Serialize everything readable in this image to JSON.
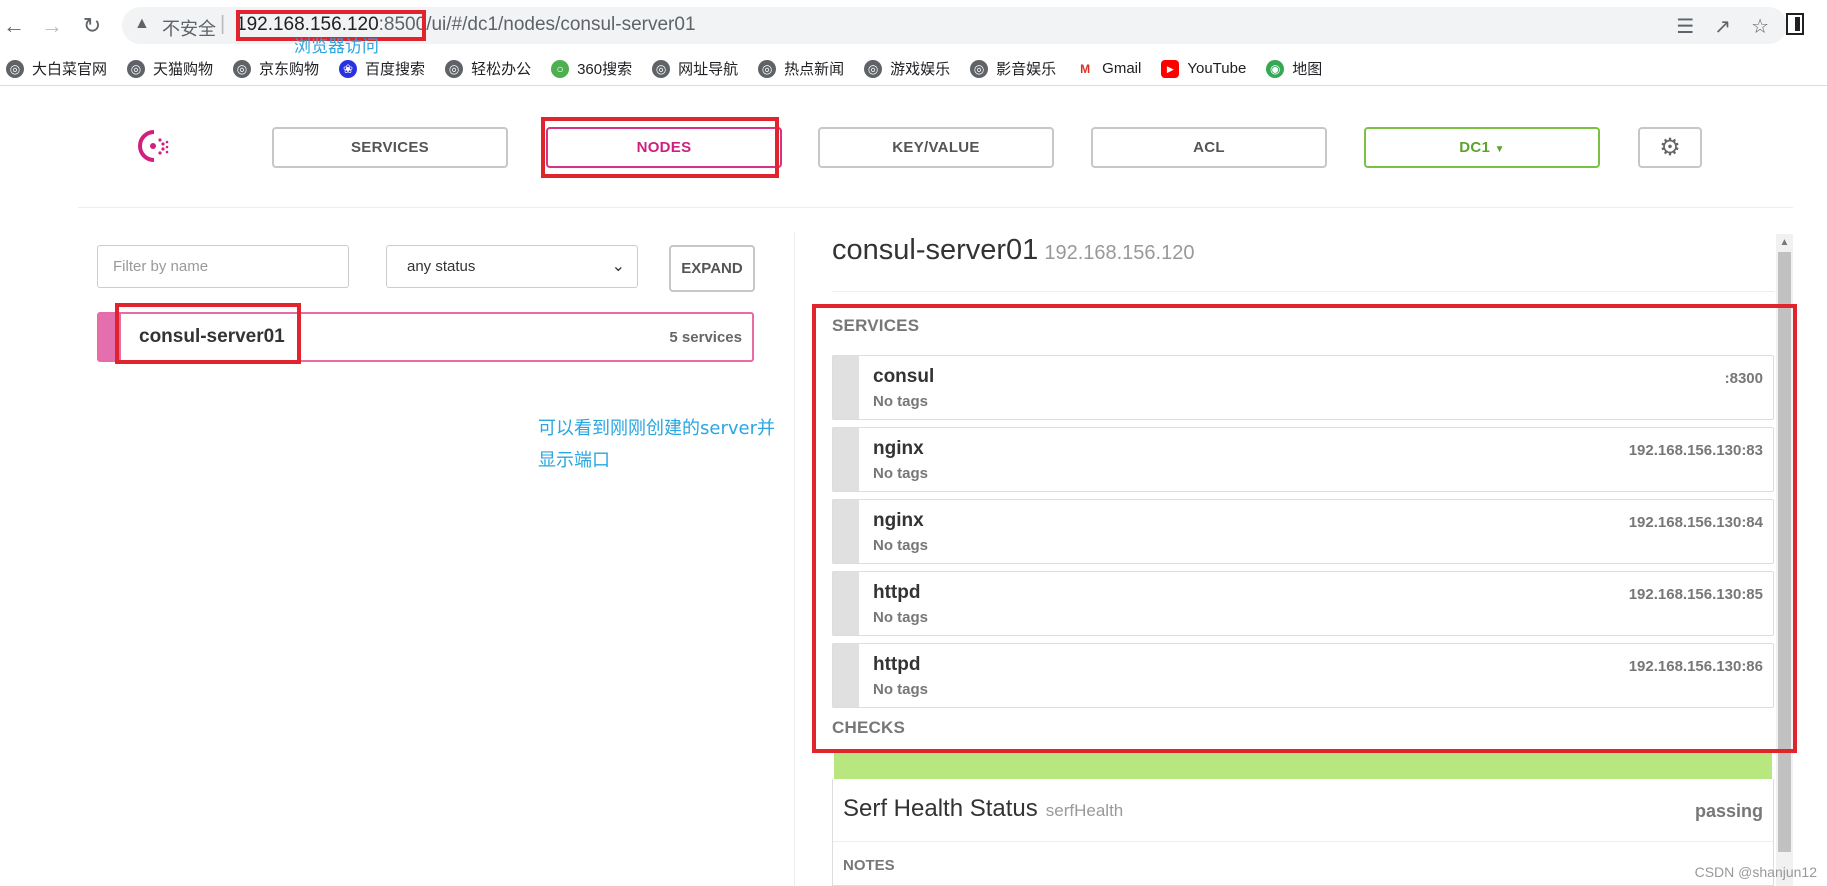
{
  "browser": {
    "security_label": "不安全",
    "url_host": "192.168.156.120",
    "url_port": ":8500",
    "url_path": "/ui/#/dc1/nodes/consul-server01",
    "bookmarks": [
      {
        "label": "大白菜官网",
        "icon": "globe-icon"
      },
      {
        "label": "天猫购物",
        "icon": "globe-icon"
      },
      {
        "label": "京东购物",
        "icon": "globe-icon"
      },
      {
        "label": "百度搜索",
        "icon": "baidu-paw-icon"
      },
      {
        "label": "轻松办公",
        "icon": "globe-icon"
      },
      {
        "label": "360搜索",
        "icon": "360-icon"
      },
      {
        "label": "网址导航",
        "icon": "globe-icon"
      },
      {
        "label": "热点新闻",
        "icon": "globe-icon"
      },
      {
        "label": "游戏娱乐",
        "icon": "globe-icon"
      },
      {
        "label": "影音娱乐",
        "icon": "globe-icon"
      },
      {
        "label": "Gmail",
        "icon": "gmail-icon"
      },
      {
        "label": "YouTube",
        "icon": "youtube-icon"
      },
      {
        "label": "地图",
        "icon": "maps-icon"
      }
    ]
  },
  "annotations": {
    "url_note": "浏览器访问",
    "server_note_line1": "可以看到刚刚创建的server并",
    "server_note_line2": "显示端口",
    "watermark": "CSDN @shanjun12",
    "highlight_color": "#e0242e"
  },
  "nav": {
    "services": "SERVICES",
    "nodes": "NODES",
    "keyvalue": "KEY/VALUE",
    "acl": "ACL",
    "dc": "DC1",
    "active": "nodes",
    "accent_color": "#d0207e",
    "dc_color": "#5ca32f"
  },
  "filters": {
    "name_placeholder": "Filter by name",
    "status_value": "any status",
    "expand_label": "EXPAND"
  },
  "node_list": [
    {
      "name": "consul-server01",
      "services": "5 services"
    }
  ],
  "node_detail": {
    "name": "consul-server01",
    "address": "192.168.156.120",
    "services_header": "SERVICES",
    "checks_header": "CHECKS",
    "services": [
      {
        "name": "consul",
        "tags": "No tags",
        "address": ":8300"
      },
      {
        "name": "nginx",
        "tags": "No tags",
        "address": "192.168.156.130:83"
      },
      {
        "name": "nginx",
        "tags": "No tags",
        "address": "192.168.156.130:84"
      },
      {
        "name": "httpd",
        "tags": "No tags",
        "address": "192.168.156.130:85"
      },
      {
        "name": "httpd",
        "tags": "No tags",
        "address": "192.168.156.130:86"
      }
    ],
    "check": {
      "name": "Serf Health Status",
      "id": "serfHealth",
      "status": "passing",
      "notes_label": "NOTES",
      "status_color": "#b9e77f"
    }
  }
}
